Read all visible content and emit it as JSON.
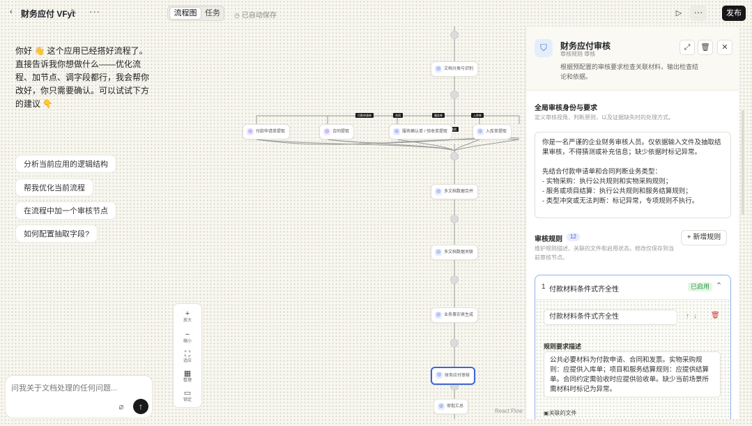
{
  "header": {
    "back_icon": "chevron-left",
    "app_title": "财务应付 VFyt",
    "edit_icon": "pencil",
    "more_icon": "more-horizontal",
    "tabs": [
      "流程图",
      "任务"
    ],
    "active_tab": "流程图",
    "save_status": "已自动保存",
    "publish_label": "发布"
  },
  "chat": {
    "greeting_lines": [
      "你好 👋 这个应用已经搭好流程了。",
      "直接告诉我你想做什么——优化流程、加节点、调字段都行，我会帮你改好，你只需要确认。可以试试下方的建议 👇"
    ],
    "suggestions": [
      "分析当前应用的逻辑结构",
      "帮我优化当前流程",
      "在流程中加一个审核节点",
      "如何配置抽取字段?"
    ],
    "input_placeholder": "问我关于文档处理的任何问题..."
  },
  "canvas": {
    "controls": [
      {
        "icon": "plus",
        "label": "放大"
      },
      {
        "icon": "minus",
        "label": "缩小"
      },
      {
        "icon": "fit",
        "label": "适应"
      },
      {
        "icon": "grid",
        "label": "整理"
      },
      {
        "icon": "lock",
        "label": "锁定"
      }
    ],
    "attribution": "React Flow",
    "nodes": [
      {
        "label": "文档分类与识别",
        "kind": "blue"
      },
      {
        "label": "付款申请单提取",
        "kind": "purple"
      },
      {
        "label": "合同提取",
        "kind": "purple"
      },
      {
        "label": "服务确认单 / 验收单提取",
        "kind": "blue"
      },
      {
        "label": "入库单提取",
        "kind": "blue"
      },
      {
        "label": "多文档数据合并",
        "kind": "blue"
      },
      {
        "label": "多文档数据关联",
        "kind": "blue"
      },
      {
        "label": "业务事实表生成",
        "kind": "blue"
      },
      {
        "label": "财务应付审核",
        "kind": "blue",
        "selected": true
      },
      {
        "label": "审批汇总",
        "kind": "blue"
      }
    ],
    "edge_tags": [
      "付款申请单",
      "合同",
      "服务单",
      "入库单",
      "其他"
    ]
  },
  "panel": {
    "title": "财务应付审核",
    "subtitle": "审核规则 审核",
    "description": "根据预配置的审核要求检查关联材料，输出检查结论和依据。",
    "global_section_title": "全局审核身份与要求",
    "global_section_desc": "定义审核视角、判断原则，以及证据缺失时的处理方式。",
    "prompt_text": "你是一名严谨的企业财务审核人员。仅依据输入文件及抽取结果审核，不得猜测或补充信息；缺少依据时标记异常。\n\n先结合付款申请单和合同判断业务类型：\n- 实物采购：执行公共规则和实物采购规则；\n- 服务或项目结算：执行公共规则和服务结算规则；\n- 类型冲突或无法判断：标记异常，专项规则不执行。",
    "rules_title": "审核规则",
    "rules_count": "12",
    "rules_desc": "维护规则描述、关联的文件和启用状态。修改仅保存到当前审核节点。",
    "add_rule_label": "新增规则",
    "rule": {
      "index": "1",
      "name": "付款材料条件式齐全性",
      "status": "已启用",
      "name_value": "付款材料条件式齐全性",
      "req_label": "规则要求描述",
      "req_text": "公共必要材料为付款申请、合同和发票。实物采购规则：应提供入库单；项目和服务结算规则：应提供结算单。合同约定需验收时应提供验收单。缺少当前场景所需材料时标记为异常。",
      "related_label": "关联的文件"
    }
  },
  "colors": {
    "accent": "#3f65d6",
    "publish_bg": "#17171a",
    "enabled_green": "#2f9a45",
    "delete_red": "#d93a3a"
  }
}
